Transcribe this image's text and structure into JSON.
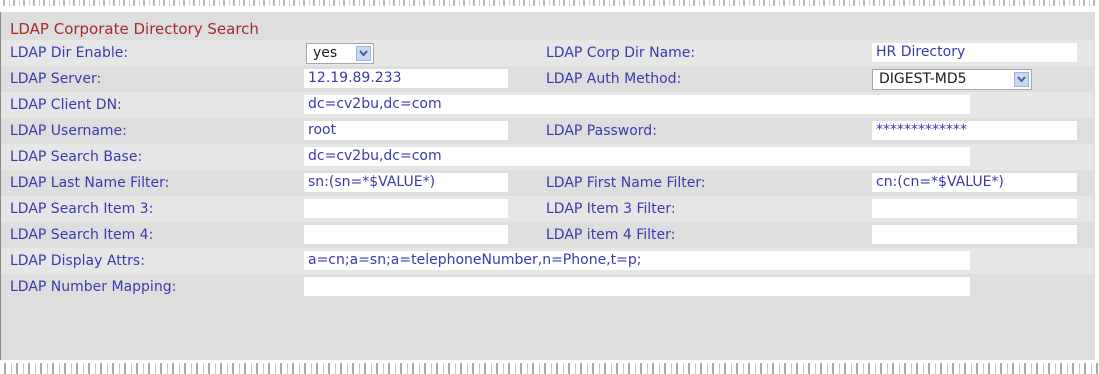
{
  "section_title": "LDAP Corporate Directory Search",
  "rows": [
    {
      "left_label": "LDAP Dir Enable:",
      "left_select": "yes",
      "right_label": "LDAP Corp Dir Name:",
      "right_value": "HR Directory"
    },
    {
      "left_label": "LDAP Server:",
      "left_value": "12.19.89.233",
      "right_label": "LDAP Auth Method:",
      "right_select": "DIGEST-MD5"
    },
    {
      "left_label": "LDAP Client DN:",
      "left_value": "dc=cv2bu,dc=com"
    },
    {
      "left_label": "LDAP Username:",
      "left_value": "root",
      "right_label": "LDAP Password:",
      "right_value": "*************"
    },
    {
      "left_label": "LDAP Search Base:",
      "left_value": "dc=cv2bu,dc=com"
    },
    {
      "left_label": "LDAP Last Name Filter:",
      "left_value": "sn:(sn=*$VALUE*)",
      "right_label": "LDAP First Name Filter:",
      "right_value": "cn:(cn=*$VALUE*)"
    },
    {
      "left_label": "LDAP Search Item 3:",
      "left_value": "",
      "right_label": "LDAP Item 3 Filter:",
      "right_value": ""
    },
    {
      "left_label": "LDAP Search Item 4:",
      "left_value": "",
      "right_label": "LDAP item 4 Filter:",
      "right_value": ""
    },
    {
      "left_label": "LDAP Display Attrs:",
      "left_value": "a=cn;a=sn;a=telephoneNumber,n=Phone,t=p;"
    },
    {
      "left_label": "LDAP Number Mapping:",
      "left_value": ""
    }
  ],
  "colors": {
    "title": "#a52a2a",
    "label": "#3a3aaf",
    "row_light": "#e6e6e6",
    "row_dark": "#dedede"
  },
  "icons": {
    "select_arrow": "chevron-down-icon"
  }
}
